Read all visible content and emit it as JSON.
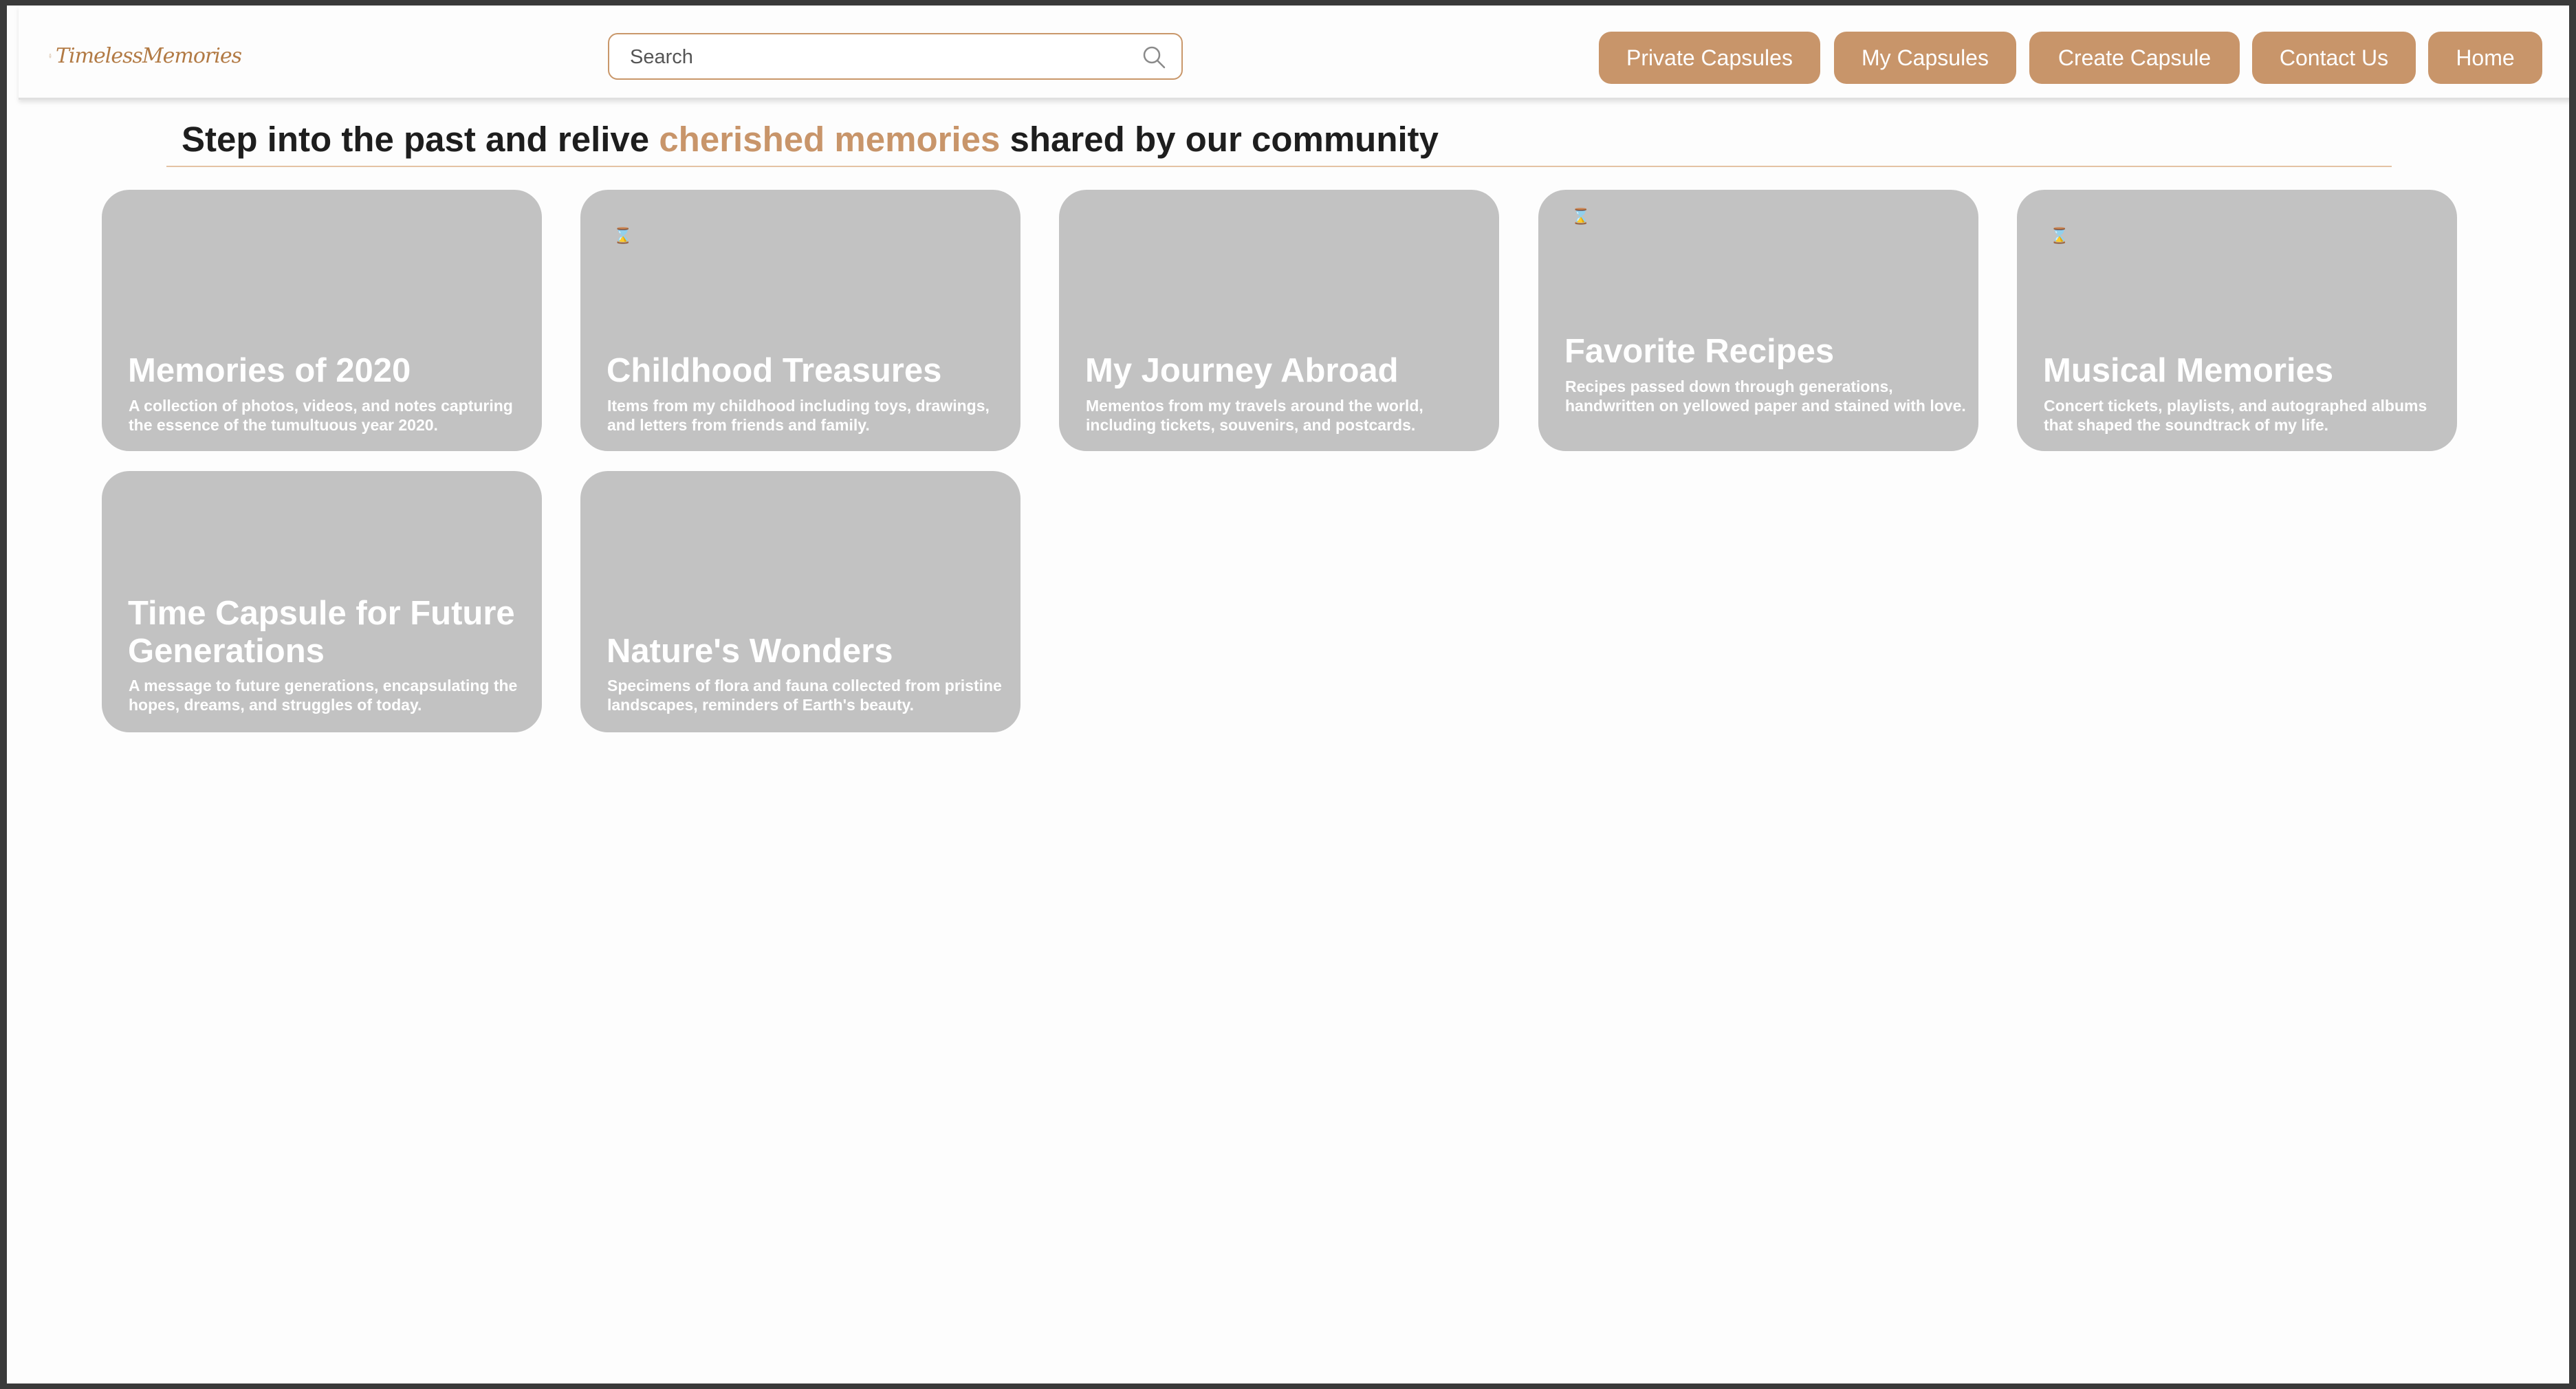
{
  "brand": {
    "name": "TimelessMemories",
    "color": "#b27a44"
  },
  "search": {
    "placeholder": "Search",
    "value": ""
  },
  "nav": {
    "buttons": [
      {
        "label": "Private Capsules"
      },
      {
        "label": "My Capsules"
      },
      {
        "label": "Create Capsule"
      },
      {
        "label": "Contact Us"
      },
      {
        "label": "Home"
      }
    ],
    "button_color": "#c8956a"
  },
  "headline": {
    "before": "Step into the past and relive ",
    "accent": "cherished memories",
    "after": " shared by our community",
    "accent_color": "#c8956a"
  },
  "capsules": [
    {
      "title": "Memories of 2020",
      "description": "A collection of photos, videos, and notes capturing the essence of the tumultuous year 2020.",
      "icon": ""
    },
    {
      "title": "Childhood Treasures",
      "description": "Items from my childhood including toys, drawings, and letters from friends and family.",
      "icon": "hourglass-icon"
    },
    {
      "title": "My Journey Abroad",
      "description": "Mementos from my travels around the world, including tickets, souvenirs, and postcards.",
      "icon": ""
    },
    {
      "title": "Favorite Recipes",
      "description": "Recipes passed down through generations, handwritten on yellowed paper and stained with love.",
      "icon": "hourglass-icon"
    },
    {
      "title": "Musical Memories",
      "description": "Concert tickets, playlists, and autographed albums that shaped the soundtrack of my life.",
      "icon": "hourglass-icon"
    },
    {
      "title": "Time Capsule for Future Generations",
      "description": "A message to future generations, encapsulating the hopes, dreams, and struggles of today.",
      "icon": ""
    },
    {
      "title": "Nature's Wonders",
      "description": "Specimens of flora and fauna collected from pristine landscapes, reminders of Earth's beauty.",
      "icon": ""
    }
  ],
  "card_color": "#c2c2c2"
}
